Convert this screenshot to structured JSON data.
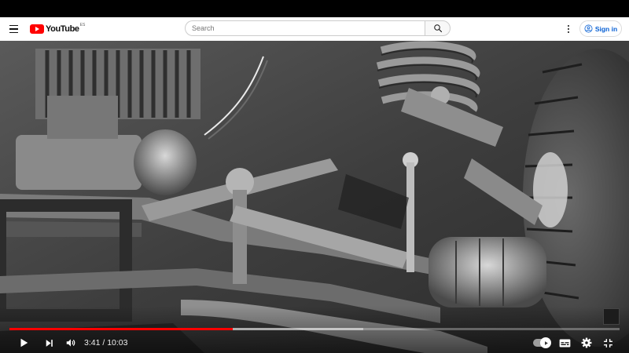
{
  "masthead": {
    "logo_text": "YouTube",
    "logo_region": "ES",
    "search_placeholder": "Search",
    "signin_label": "Sign in",
    "brand_color": "#ff0000",
    "link_color": "#065fd4"
  },
  "player": {
    "current_time": "3:41",
    "duration": "10:03",
    "time_separator": " / ",
    "progress_fraction": 0.366,
    "loaded_fraction": 0.58,
    "autoplay_on": true,
    "icons": {
      "play": "play-icon",
      "next": "next-icon",
      "volume": "volume-icon",
      "subtitles": "subtitles-icon",
      "settings": "gear-icon",
      "fullscreen_exit": "fullscreen-exit-icon"
    }
  }
}
